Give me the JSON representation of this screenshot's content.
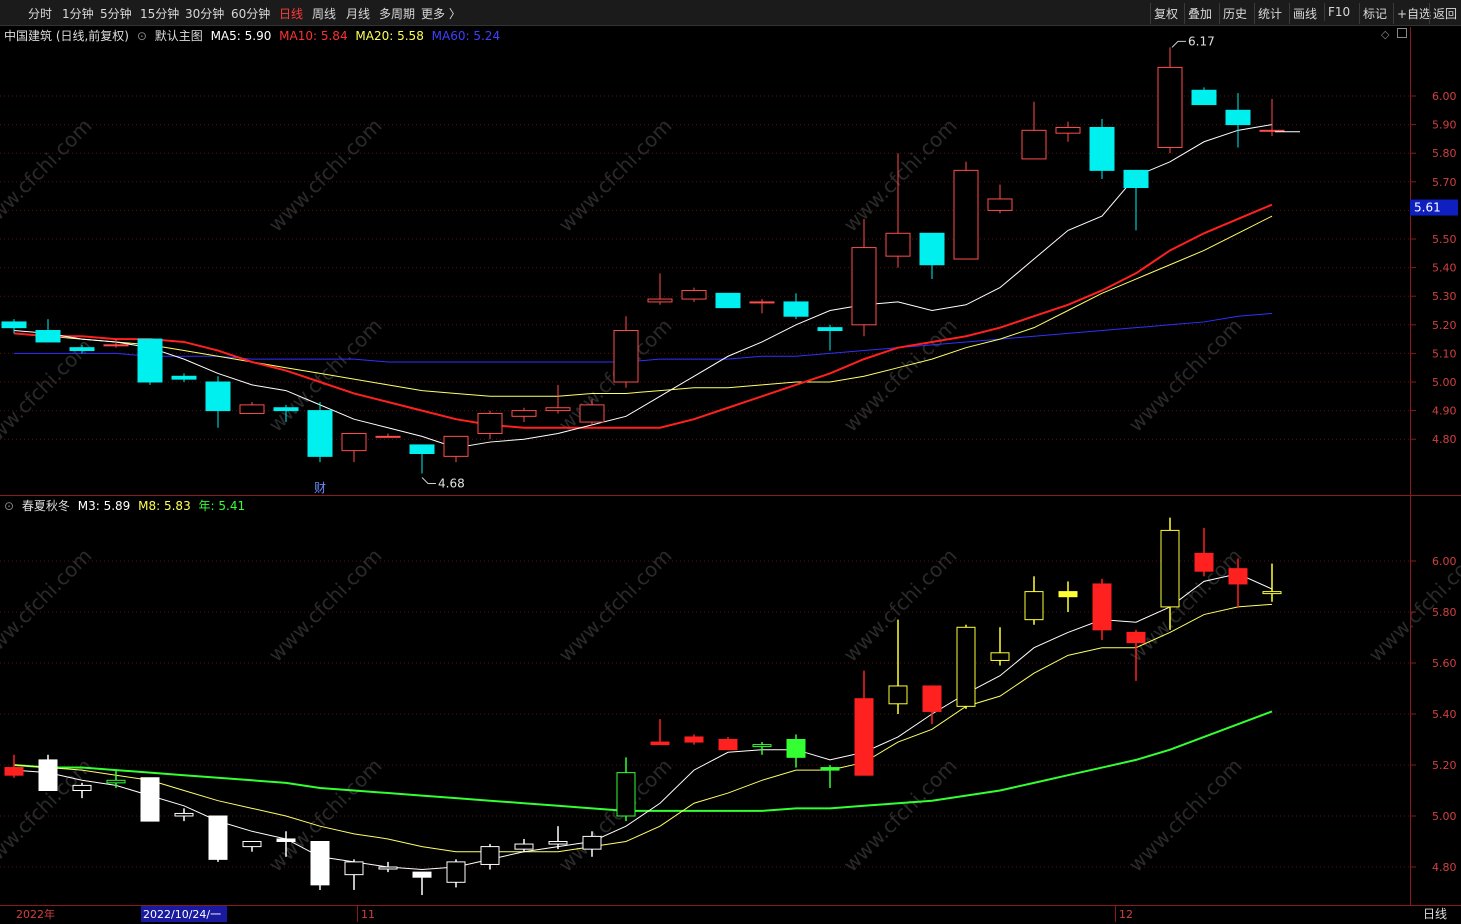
{
  "toolbar": {
    "periods": [
      "分时",
      "1分钟",
      "5分钟",
      "15分钟",
      "30分钟",
      "60分钟",
      "日线",
      "周线",
      "月线",
      "多周期",
      "更多 〉"
    ],
    "active_period": "日线",
    "right_buttons": [
      "复权",
      "叠加",
      "历史",
      "统计",
      "画线",
      "F10",
      "标记",
      "+自选",
      "返回"
    ]
  },
  "main_panel": {
    "stock_title": "中国建筑 (日线,前复权)",
    "template_label": "默认主图",
    "ma5": "MA5: 5.90",
    "ma10": "MA10: 5.84",
    "ma20": "MA20: 5.58",
    "ma60": "MA60: 5.24",
    "price_tag": "5.61",
    "high_label": "6.17",
    "low_label": "4.68",
    "event_marker": "财",
    "y_ticks": [
      "6.00",
      "5.90",
      "5.80",
      "5.70",
      "5.60",
      "5.50",
      "5.40",
      "5.30",
      "5.20",
      "5.10",
      "5.00",
      "4.90",
      "4.80"
    ]
  },
  "sub_panel": {
    "indicator_name": "春夏秋冬",
    "m3": "M3: 5.89",
    "m8": "M8: 5.83",
    "year": "年: 5.41",
    "y_ticks": [
      "6.00",
      "5.80",
      "5.60",
      "5.40",
      "5.20",
      "5.00",
      "4.80"
    ]
  },
  "date_axis": {
    "start_label": "2022年",
    "cursor_date": "2022/10/24/一",
    "month_11": "11",
    "month_12": "12",
    "period_tag": "日线"
  },
  "watermark": "www.cfchi.com",
  "colors": {
    "up_candle": "#ff4d4d",
    "down_candle": "#00f0f0",
    "ma5": "#ffffff",
    "ma10": "#ff2020",
    "ma20": "#ffff66",
    "ma60": "#3030ff",
    "year_line": "#33ff33"
  },
  "chart_data": {
    "type": "candlestick",
    "series_ohlc": [
      [
        5.21,
        5.22,
        5.17,
        5.19
      ],
      [
        5.18,
        5.22,
        5.14,
        5.14
      ],
      [
        5.12,
        5.13,
        5.1,
        5.11
      ],
      [
        5.13,
        5.15,
        5.12,
        5.13
      ],
      [
        5.15,
        5.15,
        4.99,
        5.0
      ],
      [
        5.02,
        5.03,
        5.0,
        5.01
      ],
      [
        5.0,
        5.02,
        4.84,
        4.9
      ],
      [
        4.89,
        4.93,
        4.89,
        4.92
      ],
      [
        4.91,
        4.92,
        4.86,
        4.9
      ],
      [
        4.9,
        4.93,
        4.72,
        4.74
      ],
      [
        4.76,
        4.82,
        4.72,
        4.82
      ],
      [
        4.81,
        4.82,
        4.81,
        4.81
      ],
      [
        4.78,
        4.78,
        4.68,
        4.75
      ],
      [
        4.74,
        4.81,
        4.72,
        4.81
      ],
      [
        4.82,
        4.9,
        4.8,
        4.89
      ],
      [
        4.88,
        4.91,
        4.86,
        4.9
      ],
      [
        4.9,
        4.99,
        4.89,
        4.91
      ],
      [
        4.86,
        4.94,
        4.85,
        4.92
      ],
      [
        5.0,
        5.23,
        4.98,
        5.18
      ],
      [
        5.28,
        5.38,
        5.27,
        5.29
      ],
      [
        5.29,
        5.33,
        5.28,
        5.32
      ],
      [
        5.31,
        5.31,
        5.27,
        5.26
      ],
      [
        5.28,
        5.29,
        5.24,
        5.28
      ],
      [
        5.28,
        5.31,
        5.22,
        5.23
      ],
      [
        5.19,
        5.2,
        5.11,
        5.18
      ],
      [
        5.2,
        5.57,
        5.16,
        5.47
      ],
      [
        5.44,
        5.8,
        5.4,
        5.52
      ],
      [
        5.52,
        5.52,
        5.36,
        5.41
      ],
      [
        5.43,
        5.77,
        5.44,
        5.74
      ],
      [
        5.6,
        5.69,
        5.59,
        5.64
      ],
      [
        5.78,
        5.98,
        5.8,
        5.88
      ],
      [
        5.87,
        5.91,
        5.84,
        5.89
      ],
      [
        5.89,
        5.92,
        5.71,
        5.74
      ],
      [
        5.74,
        5.74,
        5.53,
        5.68
      ],
      [
        5.82,
        6.17,
        5.8,
        6.1
      ],
      [
        6.02,
        6.03,
        5.97,
        5.97
      ],
      [
        5.95,
        6.01,
        5.82,
        5.9
      ],
      [
        5.88,
        5.99,
        5.86,
        5.88
      ]
    ],
    "sub_ohlc": [
      [
        5.19,
        5.24,
        5.15,
        5.16
      ],
      [
        5.22,
        5.24,
        5.1,
        5.1
      ],
      [
        5.1,
        5.13,
        5.07,
        5.12
      ],
      [
        5.13,
        5.18,
        5.11,
        5.14
      ],
      [
        5.15,
        5.15,
        4.98,
        4.98
      ],
      [
        5.0,
        5.03,
        4.98,
        5.01
      ],
      [
        5.0,
        5.0,
        4.82,
        4.83
      ],
      [
        4.88,
        4.9,
        4.86,
        4.9
      ],
      [
        4.91,
        4.94,
        4.84,
        4.9
      ],
      [
        4.9,
        4.9,
        4.71,
        4.73
      ],
      [
        4.77,
        4.83,
        4.71,
        4.82
      ],
      [
        4.8,
        4.82,
        4.78,
        4.8
      ],
      [
        4.78,
        4.78,
        4.69,
        4.76
      ],
      [
        4.74,
        4.83,
        4.72,
        4.82
      ],
      [
        4.81,
        4.89,
        4.79,
        4.88
      ],
      [
        4.87,
        4.91,
        4.86,
        4.89
      ],
      [
        4.89,
        4.96,
        4.87,
        4.9
      ],
      [
        4.87,
        4.94,
        4.84,
        4.92
      ],
      [
        5.0,
        5.23,
        4.98,
        5.17
      ],
      [
        5.29,
        5.38,
        5.28,
        5.28
      ],
      [
        5.29,
        5.32,
        5.28,
        5.31
      ],
      [
        5.3,
        5.31,
        5.27,
        5.26
      ],
      [
        5.28,
        5.29,
        5.24,
        5.28
      ],
      [
        5.3,
        5.32,
        5.19,
        5.23
      ],
      [
        5.19,
        5.2,
        5.11,
        5.18
      ],
      [
        5.16,
        5.57,
        5.16,
        5.46
      ],
      [
        5.44,
        5.77,
        5.4,
        5.51
      ],
      [
        5.51,
        5.51,
        5.36,
        5.41
      ],
      [
        5.43,
        5.75,
        5.42,
        5.74
      ],
      [
        5.61,
        5.74,
        5.59,
        5.64
      ],
      [
        5.77,
        5.94,
        5.75,
        5.88
      ],
      [
        5.88,
        5.92,
        5.8,
        5.86
      ],
      [
        5.91,
        5.93,
        5.69,
        5.73
      ],
      [
        5.72,
        5.73,
        5.53,
        5.68
      ],
      [
        5.82,
        6.17,
        5.73,
        6.12
      ],
      [
        6.03,
        6.13,
        5.94,
        5.96
      ],
      [
        5.97,
        6.01,
        5.82,
        5.91
      ],
      [
        5.88,
        5.99,
        5.84,
        5.88
      ]
    ],
    "ma5": [
      5.18,
      5.17,
      5.15,
      5.14,
      5.12,
      5.08,
      5.03,
      4.99,
      4.97,
      4.92,
      4.87,
      4.84,
      4.81,
      4.77,
      4.79,
      4.8,
      4.82,
      4.85,
      4.88,
      4.95,
      5.02,
      5.09,
      5.14,
      5.2,
      5.25,
      5.27,
      5.28,
      5.25,
      5.27,
      5.33,
      5.43,
      5.53,
      5.58,
      5.72,
      5.77,
      5.84,
      5.88,
      5.9
    ],
    "ma10": [
      5.17,
      5.16,
      5.16,
      5.15,
      5.15,
      5.14,
      5.11,
      5.07,
      5.04,
      5.0,
      4.96,
      4.93,
      4.9,
      4.87,
      4.85,
      4.84,
      4.84,
      4.84,
      4.84,
      4.84,
      4.87,
      4.91,
      4.95,
      4.99,
      5.03,
      5.08,
      5.12,
      5.14,
      5.16,
      5.19,
      5.23,
      5.27,
      5.32,
      5.38,
      5.46,
      5.52,
      5.57,
      5.62,
      5.67,
      5.71,
      5.74,
      5.77,
      5.8,
      5.84
    ],
    "ma20": [
      5.17,
      5.16,
      5.15,
      5.14,
      5.13,
      5.11,
      5.09,
      5.07,
      5.05,
      5.03,
      5.01,
      4.99,
      4.97,
      4.96,
      4.95,
      4.95,
      4.95,
      4.96,
      4.96,
      4.97,
      4.98,
      4.98,
      4.99,
      5.0,
      5.0,
      5.02,
      5.05,
      5.08,
      5.12,
      5.15,
      5.19,
      5.25,
      5.31,
      5.36,
      5.41,
      5.46,
      5.52,
      5.58
    ],
    "ma60": [
      5.1,
      5.1,
      5.1,
      5.1,
      5.09,
      5.09,
      5.09,
      5.08,
      5.08,
      5.08,
      5.08,
      5.07,
      5.07,
      5.07,
      5.07,
      5.07,
      5.07,
      5.07,
      5.07,
      5.08,
      5.08,
      5.08,
      5.09,
      5.09,
      5.1,
      5.11,
      5.12,
      5.13,
      5.14,
      5.15,
      5.16,
      5.17,
      5.18,
      5.19,
      5.2,
      5.21,
      5.23,
      5.24
    ],
    "m3": [
      5.18,
      5.17,
      5.14,
      5.12,
      5.08,
      5.04,
      4.98,
      4.94,
      4.91,
      4.84,
      4.82,
      4.8,
      4.79,
      4.8,
      4.83,
      4.86,
      4.88,
      4.9,
      4.96,
      5.05,
      5.18,
      5.25,
      5.26,
      5.26,
      5.22,
      5.25,
      5.31,
      5.4,
      5.48,
      5.55,
      5.66,
      5.72,
      5.77,
      5.76,
      5.82,
      5.92,
      5.95,
      5.89
    ],
    "m8": [
      5.2,
      5.19,
      5.18,
      5.16,
      5.14,
      5.1,
      5.06,
      5.03,
      5.0,
      4.96,
      4.93,
      4.91,
      4.88,
      4.86,
      4.86,
      4.86,
      4.86,
      4.88,
      4.9,
      4.96,
      5.05,
      5.09,
      5.14,
      5.18,
      5.18,
      5.21,
      5.29,
      5.34,
      5.43,
      5.47,
      5.56,
      5.63,
      5.66,
      5.66,
      5.72,
      5.79,
      5.82,
      5.83
    ],
    "year_line": [
      5.2,
      5.19,
      5.19,
      5.18,
      5.17,
      5.16,
      5.15,
      5.14,
      5.13,
      5.11,
      5.1,
      5.09,
      5.08,
      5.07,
      5.06,
      5.05,
      5.04,
      5.03,
      5.02,
      5.02,
      5.02,
      5.02,
      5.02,
      5.03,
      5.03,
      5.04,
      5.05,
      5.06,
      5.08,
      5.1,
      5.13,
      5.16,
      5.19,
      5.22,
      5.26,
      5.31,
      5.36,
      5.41
    ]
  }
}
